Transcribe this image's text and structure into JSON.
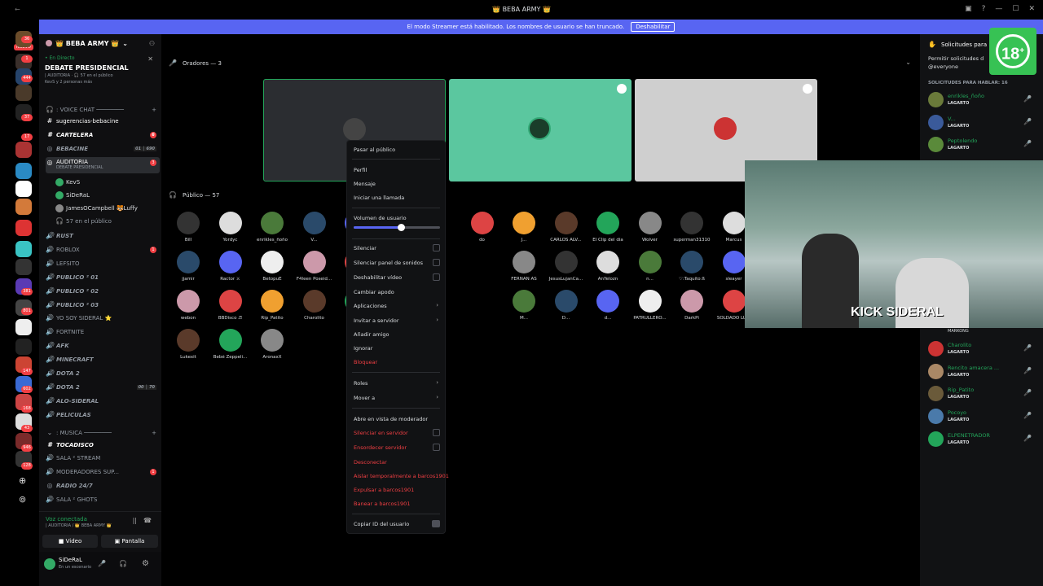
{
  "titlebar": {
    "title": "👑 BEBA ARMY 👑"
  },
  "banner": {
    "text": "El modo Streamer está habilitado. Los nombres de usuario se han truncado.",
    "button": "Deshabilitar"
  },
  "servers": {
    "nuevo": "NUEVO",
    "badges": [
      "36",
      "1",
      "444",
      "37",
      "17",
      "381",
      "801",
      "147",
      "602",
      "168",
      "43",
      "946",
      "128"
    ]
  },
  "guild": {
    "name": "👑 BEBA ARMY 👑"
  },
  "live": {
    "tag": "• En Directo",
    "title": "DEBATE PRESIDENCIAL",
    "sub": "| AUDITORIA · 🎧 57 en el público",
    "sub2": "KevS y 2 personas más"
  },
  "channels": {
    "cat_voice": ": VOICE CHAT ────────",
    "sugerencias": "sugerencias-bebacine",
    "cartelera": "CARTELERA",
    "cartelera_badge": "6",
    "bebacine": "BEBACINE",
    "bebacine_stats": "01 │ 690",
    "auditoria": "AUDITORIA",
    "auditoria_badge": "3",
    "auditoria_sub": "DEBATE PRESIDENCIAL",
    "kevs": "KevS",
    "sideral": "SiDeRaL",
    "james": "JamesOCampbell 🐯Luffy",
    "publico": "57 en el público",
    "rust": "RUST",
    "roblox": "ROBLOX",
    "roblox_badge": "1",
    "lefsito": "LEFSITO",
    "p1": "PUBLICO ² 01",
    "p2": "PUBLICO ² 02",
    "p3": "PUBLICO ² 03",
    "yosoy": "YO SOY SIDERAL ⭐",
    "fortnite": "FORTNITE",
    "afk": "AFK",
    "minecraft": "MINECRAFT",
    "dota1": "DOTA 2",
    "dota2": "DOTA 2",
    "dota2_stats": "00 │ 70",
    "alo": "ALO-SIDERAL",
    "peliculas": "PELICULAS",
    "cat_musica": ": MUSICA ────────",
    "tocadisco": "TOCADISCO",
    "sala": "SALA ² STREAM",
    "moderadores": "MODERADORES SUP...",
    "mod_badge": "1",
    "radio": "RADIO 24/7",
    "ghots": "SALA ² GHOTS"
  },
  "voice": {
    "status": "Voz conectada",
    "sub": "| AUDITORIA / 👑 BEBA ARMY 👑",
    "video": "Video",
    "pantalla": "Pantalla"
  },
  "user": {
    "name": "SiDeRaL",
    "status": "En un escenario"
  },
  "stage": {
    "speakers_label": "Oradores — 3",
    "public_label": "Público — 57"
  },
  "audience": [
    "Bill",
    "Yordyc",
    "enrikles_ñoño",
    "V...",
    "!!-S",
    "",
    "",
    "do",
    "J...",
    "CARLOS ALV...",
    "El Clip del día",
    "Wolver",
    "superman31310",
    "Marcus",
    "ELPENETRAD...",
    "jjamir",
    "Ractor ⚔",
    "BetopuE",
    "F4leen Poseid...",
    "NTR",
    "",
    "",
    "",
    "FERNAN AS",
    "JesusLujanCa...",
    "AnYelozn",
    "n...",
    "♡:Taquito:ß",
    "sleayer",
    "a...",
    "webon",
    "BBDisco ♬",
    "Rip_Patito",
    "Charolito",
    "Die",
    "",
    "",
    "",
    "M...",
    "D...",
    "d...",
    "PATRULLERO...",
    "DarkPi",
    "SOLDADO LU...",
    "Epi",
    "Lukexit",
    "Bebé Zeppeli...",
    "AronaxX"
  ],
  "menu": {
    "pasar": "Pasar al público",
    "perfil": "Perfil",
    "mensaje": "Mensaje",
    "llamada": "Iniciar una llamada",
    "volumen": "Volumen de usuario",
    "volume_level": 0.55,
    "silenciar": "Silenciar",
    "silenciar_panel": "Silenciar panel de sonidos",
    "deshab_video": "Deshabilitar vídeo",
    "cambiar": "Cambiar apodo",
    "aplicaciones": "Aplicaciones",
    "invitar": "Invitar a servidor",
    "anadir": "Añadir amigo",
    "ignorar": "Ignorar",
    "bloquear": "Bloquear",
    "roles": "Roles",
    "mover": "Mover a",
    "moderador": "Abre en vista de moderador",
    "sil_servidor": "Silenciar en servidor",
    "ensordecer": "Ensordecer servidor",
    "desconectar": "Desconectar",
    "aislar": "Aislar temporalmente a barcos1901",
    "expulsar": "Expulsar a barcos1901",
    "banear": "Banear a barcos1901",
    "copiar": "Copiar ID del usuario"
  },
  "right": {
    "title": "Solicitudes para",
    "permitir": "Permitir solicitudes d",
    "everyone": "@everyone",
    "header": "SOLICITUDES PARA HABLAR: 16",
    "role": "LAGARTO",
    "markong": "MARKONG",
    "requests_top": [
      "enrikles_ñoño",
      "V...",
      "Peptolendo"
    ],
    "requests_bottom": [
      "Charolito",
      "Rencito amacera ...",
      "Rip_Patito",
      "Pocoyo",
      "ELPENETRADOR"
    ]
  },
  "overlay": {
    "badge": "18",
    "plus": "+",
    "cam_text": "KICK SIDERAL"
  }
}
